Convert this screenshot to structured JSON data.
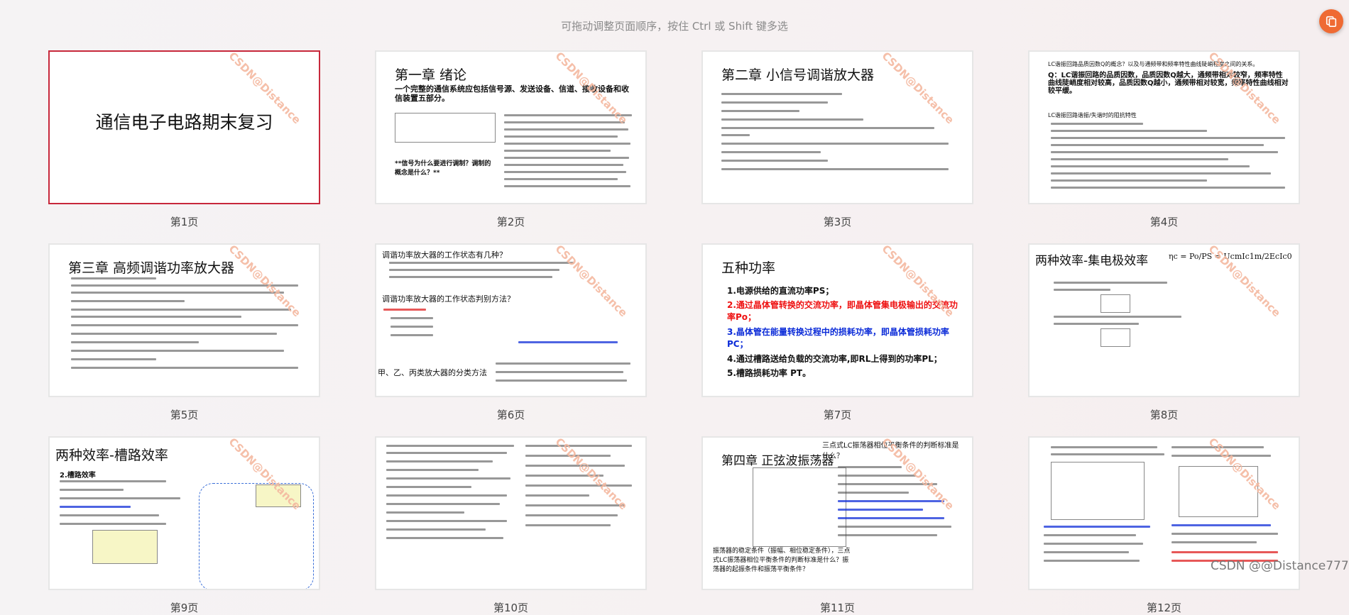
{
  "hint": "可拖动调整页面顺序，按住 Ctrl 或 Shift 键多选",
  "watermark": "CSDN@Distance",
  "corner_watermark": "CSDN @@Distance777",
  "accent_selected": "#c7283b",
  "float_button_icon": "pages-icon",
  "pages": [
    {
      "label": "第1页",
      "title": "通信电子电路期末复习"
    },
    {
      "label": "第2页",
      "title": "第一章 绪论",
      "bullet": "一个完整的通信系统应包括信号源、发送设备、信道、接收设备和收信装置五部分。",
      "q": "**信号为什么要进行调制？调制的概念是什么？**"
    },
    {
      "label": "第3页",
      "title": "第二章 小信号调谐放大器"
    },
    {
      "label": "第4页",
      "title": "LC谐振回路品质因数Q的概念？以及与通频带和频率特性曲线陡峭程度之间的关系。",
      "q": "Q：LC谐振回路的品质因数，品质因数Q越大，通频带相对较窄，频率特性曲线陡峭度相对较高，品质因数Q越小，通频带相对较宽，频率特性曲线相对较平缓。",
      "sub": "LC谐振回路谐振/失谐时的阻抗特性"
    },
    {
      "label": "第5页",
      "title": "第三章 高频调谐功率放大器"
    },
    {
      "label": "第6页",
      "title": "调谐功率放大器的工作状态有几种？",
      "sub": "调谐功率放大器的工作状态判别方法？",
      "q": "甲、乙、丙类放大器的分类方法"
    },
    {
      "label": "第7页",
      "title": "五种功率",
      "items": [
        "1.电源供给的直流功率PS；",
        "2.通过晶体管转换的交流功率，即晶体管集电极输出的交流功率Po；",
        "3.晶体管在能量转换过程中的损耗功率，即晶体管损耗功率PC；",
        "4.通过槽路送给负载的交流功率,即RL上得到的功率PL；",
        "5.槽路损耗功率 PT。"
      ]
    },
    {
      "label": "第8页",
      "title": "两种效率-集电极效率",
      "formula": "ηc = Po/PS = UcmIc1m/2EcIc0"
    },
    {
      "label": "第9页",
      "title": "两种效率-槽路效率",
      "sub": "2.槽路效率"
    },
    {
      "label": "第10页"
    },
    {
      "label": "第11页",
      "title": "第四章 正弦波振荡器",
      "q": "振荡器的稳定条件（振幅、相位稳定条件），三点式LC振荡器相位平衡条件的判断标准是什么？振荡器的起振条件和振荡平衡条件？",
      "side": "三点式LC振荡器相位平衡条件的判断标准是什么？"
    },
    {
      "label": "第12页"
    }
  ]
}
